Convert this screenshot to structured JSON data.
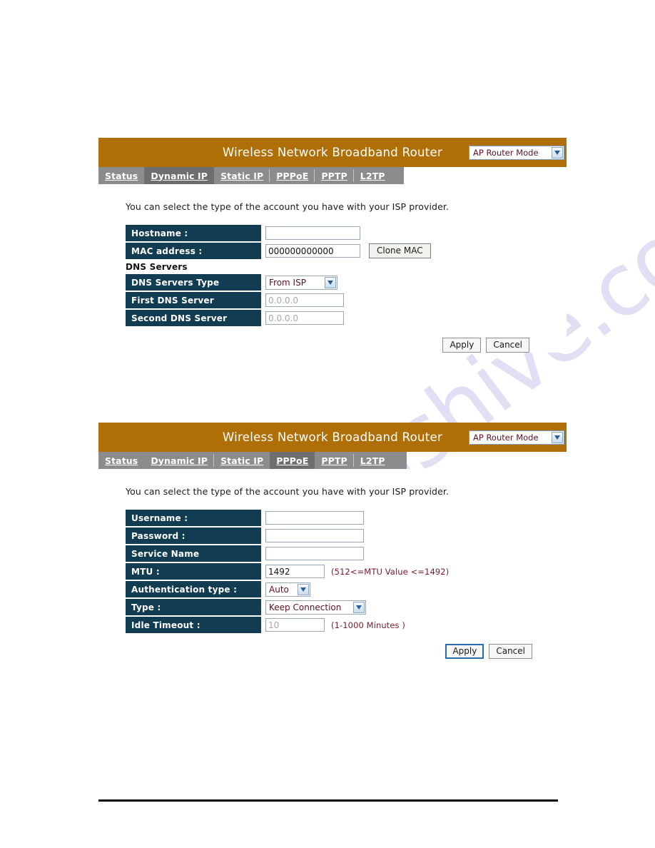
{
  "watermark": {
    "text": "manualshive.com"
  },
  "panels": [
    {
      "title": "Wireless Network Broadband Router",
      "mode_selected": "AP Router Mode",
      "tabs": [
        {
          "label": "Status",
          "active": false
        },
        {
          "label": "Dynamic IP",
          "active": true
        },
        {
          "label": "Static IP",
          "active": false
        },
        {
          "label": "PPPoE",
          "active": false
        },
        {
          "label": "PPTP",
          "active": false
        },
        {
          "label": "L2TP",
          "active": false
        }
      ],
      "intro": "You can select the type of the account you have with your ISP provider.",
      "fields": {
        "hostname_label": "Hostname :",
        "hostname_value": "",
        "mac_label": "MAC address :",
        "mac_value": "000000000000",
        "clone_mac_label": "Clone MAC",
        "dns_heading": "DNS Servers",
        "dns_type_label": "DNS Servers Type",
        "dns_type_value": "From ISP",
        "first_dns_label": "First DNS Server",
        "first_dns_value": "0.0.0.0",
        "second_dns_label": "Second DNS Server",
        "second_dns_value": "0.0.0.0"
      },
      "apply_label": "Apply",
      "cancel_label": "Cancel"
    },
    {
      "title": "Wireless Network Broadband Router",
      "mode_selected": "AP Router Mode",
      "tabs": [
        {
          "label": "Status",
          "active": false
        },
        {
          "label": "Dynamic IP",
          "active": false
        },
        {
          "label": "Static IP",
          "active": false
        },
        {
          "label": "PPPoE",
          "active": true
        },
        {
          "label": "PPTP",
          "active": false
        },
        {
          "label": "L2TP",
          "active": false
        }
      ],
      "intro": "You can select the type of the account you have with your ISP provider.",
      "fields": {
        "username_label": "Username :",
        "username_value": "",
        "password_label": "Password :",
        "password_value": "",
        "service_name_label": "Service Name",
        "service_name_value": "",
        "mtu_label": "MTU :",
        "mtu_value": "1492",
        "mtu_hint": "(512<=MTU Value <=1492)",
        "auth_label": "Authentication type :",
        "auth_value": "Auto",
        "type_label": "Type :",
        "type_value": "Keep Connection",
        "idle_label": "Idle Timeout :",
        "idle_value": "10",
        "idle_hint": "(1-1000 Minutes )"
      },
      "apply_label": "Apply",
      "cancel_label": "Cancel"
    }
  ],
  "colors": {
    "titlebar": "#b06f06",
    "label_cell": "#123c52",
    "tab_strip": "#8c8c8c",
    "tab_active": "#6e6e6e",
    "hint_text": "#7a1b2a",
    "watermark": "#c9c6ea"
  }
}
